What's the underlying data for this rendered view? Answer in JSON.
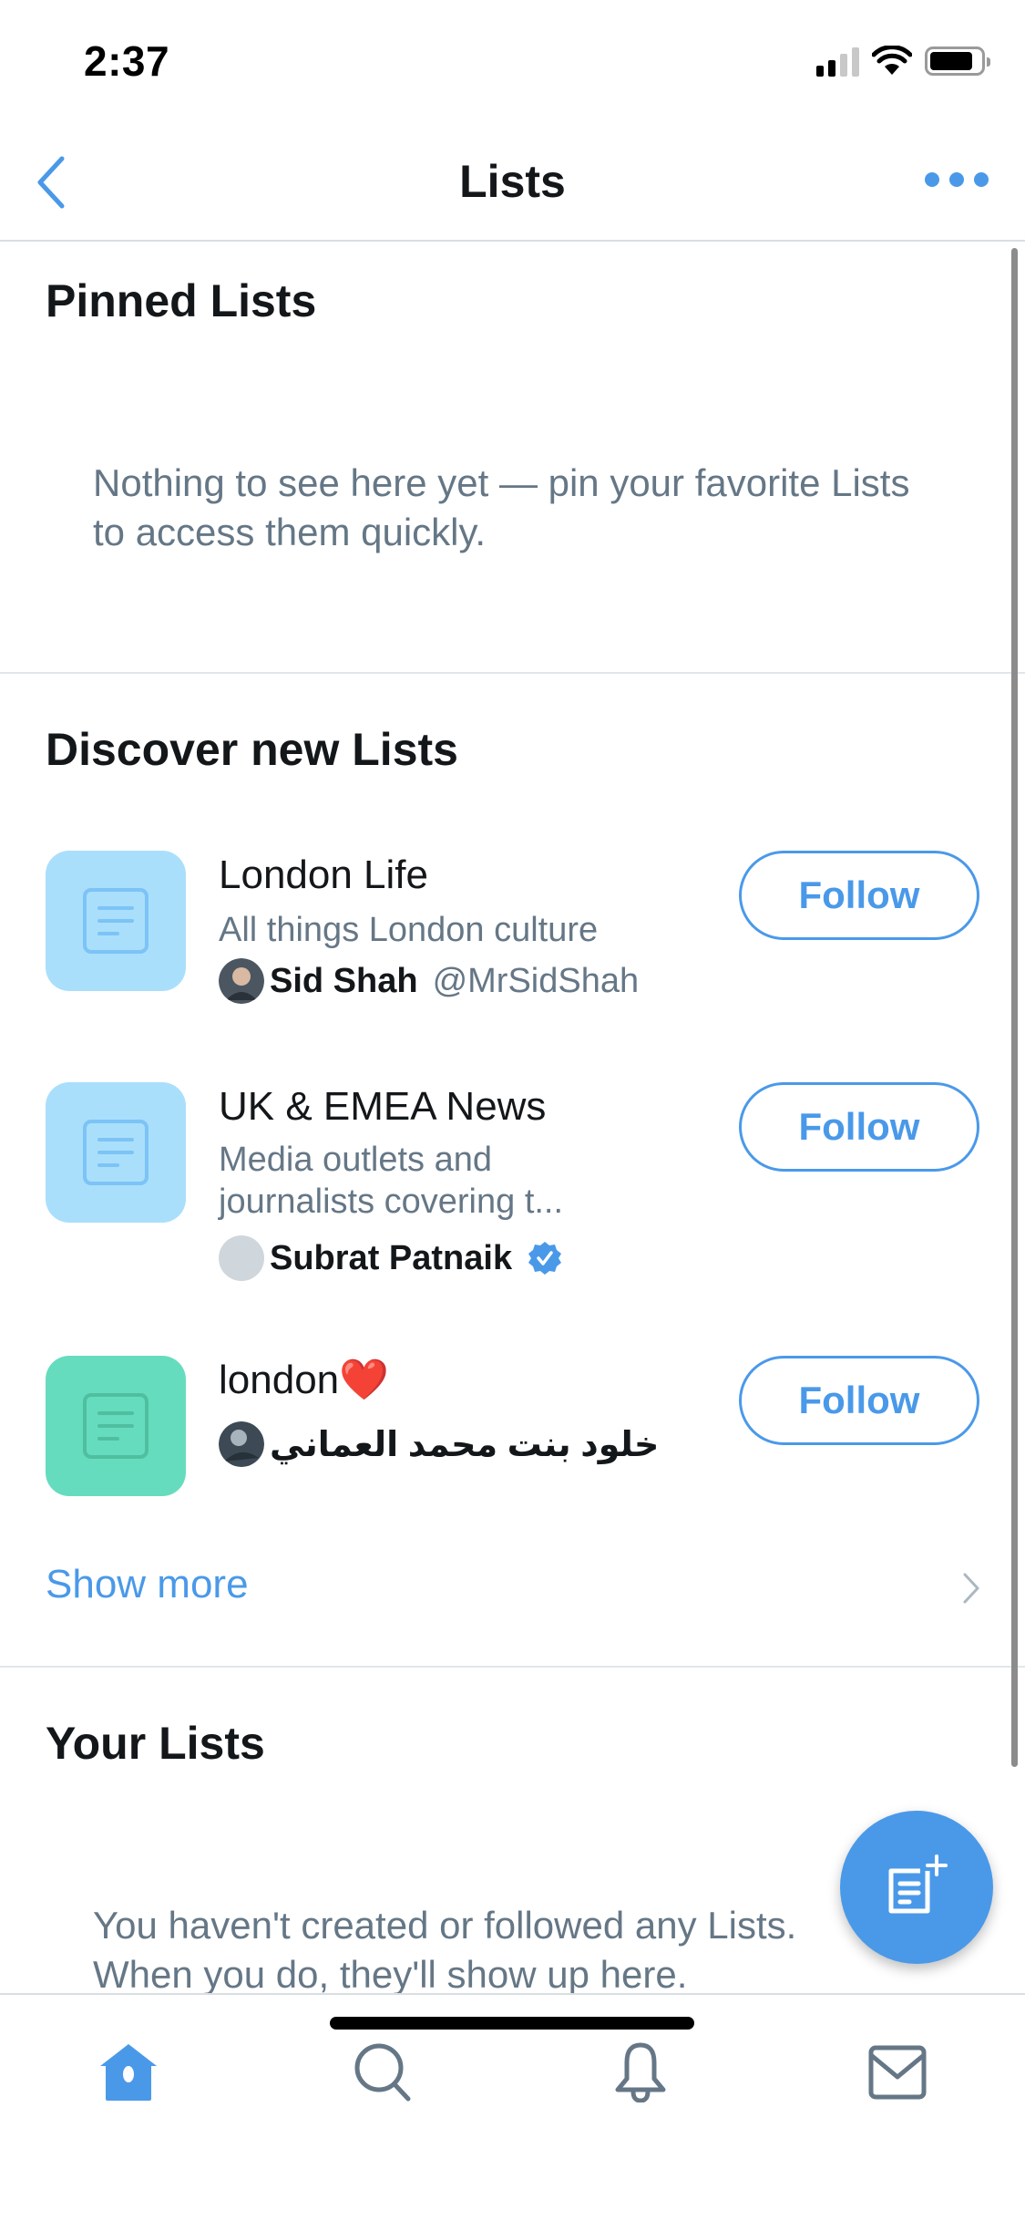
{
  "status_bar": {
    "time": "2:37",
    "signal_bars_active": 2,
    "signal_bars_total": 4,
    "battery_level_percent": 75
  },
  "nav": {
    "title": "Lists",
    "back_icon": "chevron-left-icon",
    "more_icon": "more-horizontal-icon"
  },
  "pinned": {
    "title": "Pinned Lists",
    "empty_text": "Nothing to see here yet — pin your favorite Lists to access them quickly."
  },
  "discover": {
    "title": "Discover new Lists",
    "items": [
      {
        "name": "London Life",
        "description": "All things London culture",
        "owner_name": "Sid Shah",
        "owner_handle": "@MrSidShah",
        "verified": false,
        "thumb_color": "#aadffb",
        "icon_color": "#7cc3f6",
        "follow_label": "Follow"
      },
      {
        "name": "UK & EMEA News",
        "description": "Media outlets and journalists covering t...",
        "owner_name": "Subrat Patnaik",
        "owner_handle": "",
        "verified": true,
        "thumb_color": "#aadffb",
        "icon_color": "#7cc3f6",
        "follow_label": "Follow"
      },
      {
        "name": "london❤️",
        "description": "",
        "owner_name": "خلود بنت محمد العماني",
        "owner_handle": "",
        "verified": false,
        "thumb_color": "#66dcbe",
        "icon_color": "#4fbf9f",
        "follow_label": "Follow"
      }
    ],
    "show_more_label": "Show more"
  },
  "your_lists": {
    "title": "Your Lists",
    "empty_text": "You haven't created or followed any Lists. When you do, they'll show up here."
  },
  "fab": {
    "icon": "new-list-icon"
  },
  "tab_bar": {
    "tabs": [
      {
        "name": "home",
        "icon": "home-icon",
        "active": true
      },
      {
        "name": "search",
        "icon": "search-icon",
        "active": false
      },
      {
        "name": "notifications",
        "icon": "bell-icon",
        "active": false
      },
      {
        "name": "messages",
        "icon": "mail-icon",
        "active": false
      }
    ]
  },
  "colors": {
    "accent": "#4a99e9",
    "text_primary": "#14171a",
    "text_secondary": "#657786",
    "divider": "#e1e6ea"
  }
}
